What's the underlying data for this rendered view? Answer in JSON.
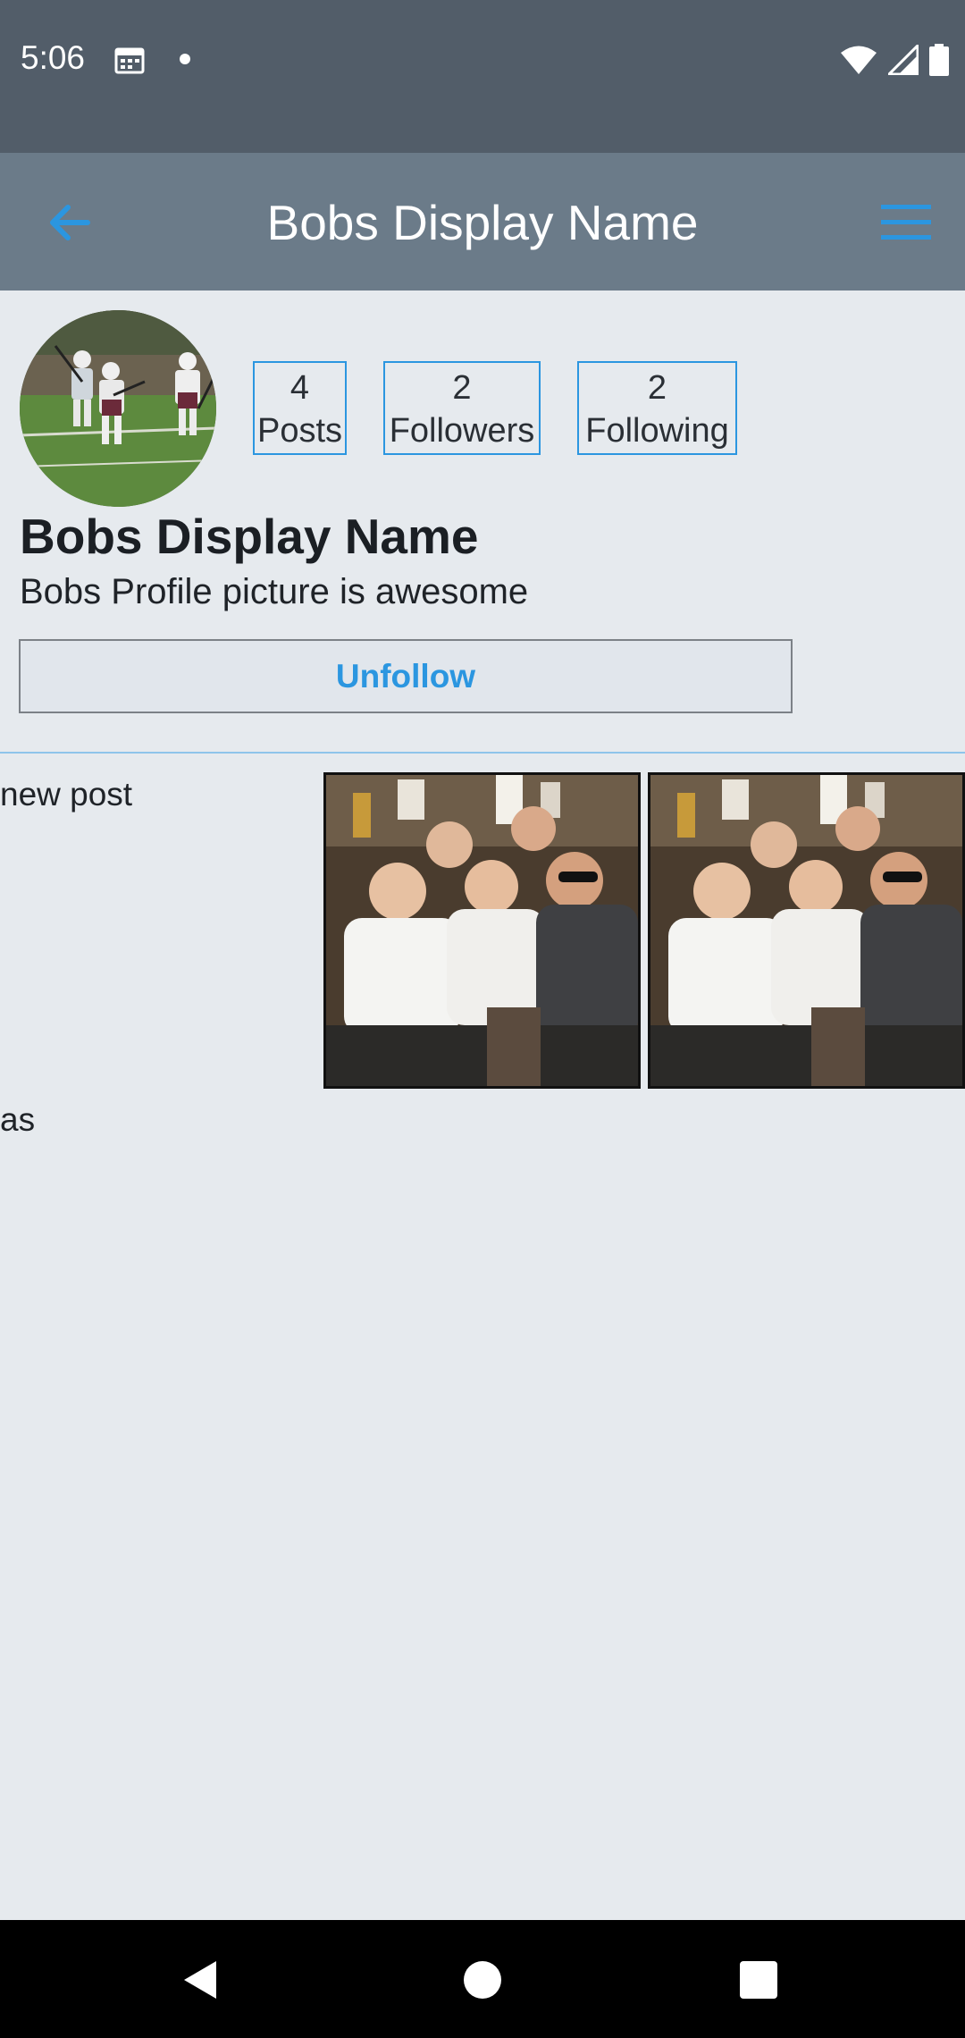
{
  "status_bar": {
    "time": "5:06",
    "icons": [
      "calendar-icon",
      "notification-dot-icon",
      "wifi-icon",
      "cell-signal-icon",
      "battery-icon"
    ]
  },
  "app_bar": {
    "title": "Bobs Display Name",
    "back_icon": "arrow-left-icon",
    "menu_icon": "hamburger-menu-icon",
    "accent_color": "#2b96e0"
  },
  "profile": {
    "display_name": "Bobs Display Name",
    "bio": "Bobs Profile picture is awesome",
    "stats": {
      "posts": {
        "count": "4",
        "label": "Posts"
      },
      "followers": {
        "count": "2",
        "label": "Followers"
      },
      "following": {
        "count": "2",
        "label": "Following"
      }
    },
    "unfollow_label": "Unfollow"
  },
  "posts": [
    {
      "caption": "new post"
    },
    {
      "caption": "as"
    }
  ],
  "nav_bar": {
    "icons": [
      "back-triangle-icon",
      "home-circle-icon",
      "recents-square-icon"
    ]
  },
  "colors": {
    "status_bar": "#525d69",
    "app_bar": "#6b7b89",
    "background": "#e6eaee",
    "accent": "#2b96e0"
  }
}
